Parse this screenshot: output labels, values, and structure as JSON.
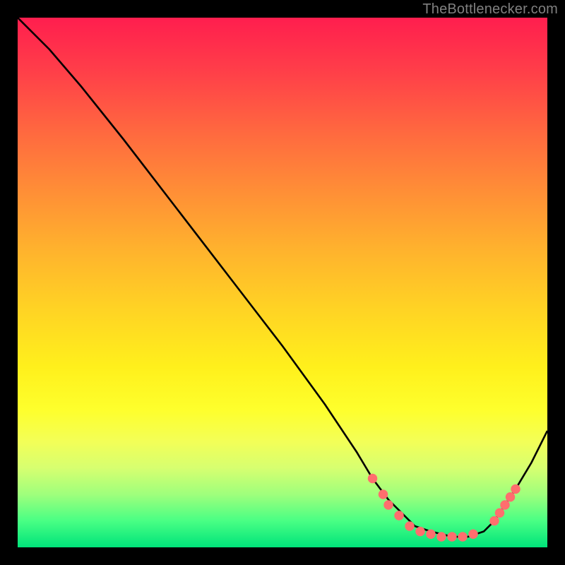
{
  "watermark": "TheBottlenecker.com",
  "chart_data": {
    "type": "line",
    "title": "",
    "xlabel": "",
    "ylabel": "",
    "xlim": [
      0,
      100
    ],
    "ylim": [
      0,
      100
    ],
    "grid": false,
    "series": [
      {
        "name": "bottleneck-curve",
        "x": [
          0,
          6,
          12,
          20,
          30,
          40,
          50,
          58,
          64,
          67,
          70,
          73,
          75,
          78,
          82,
          85,
          88,
          90,
          92,
          94,
          97,
          100
        ],
        "values": [
          100,
          94,
          87,
          77,
          64,
          51,
          38,
          27,
          18,
          13,
          9,
          6,
          4,
          3,
          2,
          2,
          3,
          5,
          8,
          11,
          16,
          22
        ]
      }
    ],
    "markers": [
      {
        "x": 67,
        "y": 13
      },
      {
        "x": 69,
        "y": 10
      },
      {
        "x": 70,
        "y": 8
      },
      {
        "x": 72,
        "y": 6
      },
      {
        "x": 74,
        "y": 4
      },
      {
        "x": 76,
        "y": 3
      },
      {
        "x": 78,
        "y": 2.5
      },
      {
        "x": 80,
        "y": 2
      },
      {
        "x": 82,
        "y": 2
      },
      {
        "x": 84,
        "y": 2
      },
      {
        "x": 86,
        "y": 2.5
      },
      {
        "x": 90,
        "y": 5
      },
      {
        "x": 91,
        "y": 6.5
      },
      {
        "x": 92,
        "y": 8
      },
      {
        "x": 93,
        "y": 9.5
      },
      {
        "x": 94,
        "y": 11
      }
    ],
    "marker_color": "#ff6e6e",
    "line_color": "#000000"
  }
}
